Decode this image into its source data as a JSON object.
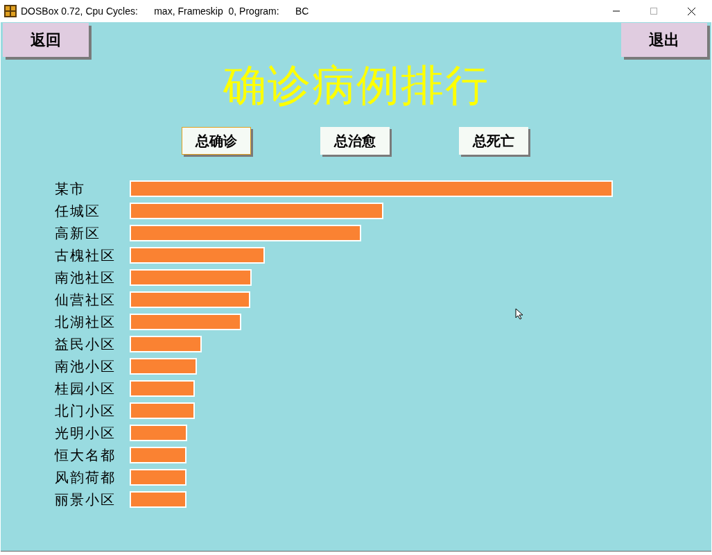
{
  "window": {
    "title": "DOSBox 0.72, Cpu Cycles:      max, Frameskip  0, Program:      BC"
  },
  "back_button": {
    "label": "返回"
  },
  "exit_button": {
    "label": "退出"
  },
  "heading": "确诊病例排行",
  "tabs": [
    {
      "label": "总确诊",
      "selected": true
    },
    {
      "label": "总治愈",
      "selected": false
    },
    {
      "label": "总死亡",
      "selected": false
    }
  ],
  "rows": [
    {
      "label": "某市",
      "level": 0.996
    },
    {
      "label": "任城区",
      "level": 0.523
    },
    {
      "label": "高新区",
      "level": 0.477
    },
    {
      "label": "古槐社区",
      "level": 0.279
    },
    {
      "label": "南池社区",
      "level": 0.251
    },
    {
      "label": "仙营社区",
      "level": 0.249
    },
    {
      "label": "北湖社区",
      "level": 0.23
    },
    {
      "label": "益民小区",
      "level": 0.149
    },
    {
      "label": "南池小区",
      "level": 0.139
    },
    {
      "label": "桂园小区",
      "level": 0.134
    },
    {
      "label": "北门小区",
      "level": 0.134
    },
    {
      "label": "光明小区",
      "level": 0.119
    },
    {
      "label": "恒大名都",
      "level": 0.117
    },
    {
      "label": "风韵荷都",
      "level": 0.117
    },
    {
      "label": "丽景小区",
      "level": 0.117
    }
  ]
}
